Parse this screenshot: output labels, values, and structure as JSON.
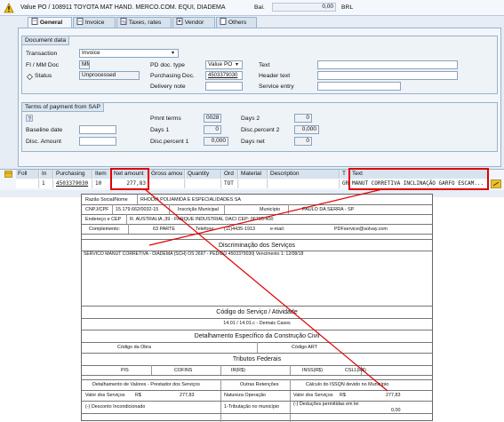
{
  "header": {
    "doc_title": "Value PO / 108911 TOYOTA MAT HAND. MERCO.COM. EQUI, DIADEMA",
    "bal_label": "Bal.",
    "bal_value": "0,00",
    "currency": "BRL"
  },
  "tabs": [
    {
      "label": "General",
      "active": true
    },
    {
      "label": "Invoice"
    },
    {
      "label": "Taxes, rates"
    },
    {
      "label": "Vendor"
    },
    {
      "label": "Others"
    }
  ],
  "document_data": {
    "title": "Document data",
    "transaction_label": "Transaction",
    "transaction_value": "Invoice",
    "fi_mm_label": "FI / MM Doc",
    "fi_mm_value": "MM",
    "status_label": "Status",
    "status_value": "Unprocessed",
    "pd_doc_type_label": "PD doc. type",
    "pd_doc_type_value": "Value PO",
    "purchasing_doc_label": "Purchasing Doc.",
    "purchasing_doc_value": "4503379030",
    "delivery_note_label": "Delivery note",
    "text_label": "Text",
    "header_text_label": "Header text",
    "service_entry_label": "Service entry"
  },
  "terms": {
    "title": "Terms of payment from SAP",
    "pmnt_terms_label": "Pmnt terms",
    "pmnt_terms_value": "0028",
    "days1_label": "Days 1",
    "days1_value": "0",
    "disc_pct1_label": "Disc.percent 1",
    "disc_pct1_value": "0,000",
    "days2_label": "Days 2",
    "days2_value": "0",
    "disc_pct2_label": "Disc.percent 2",
    "disc_pct2_value": "0,000",
    "days_net_label": "Days net",
    "days_net_value": "0",
    "baseline_date_label": "Baseline date",
    "disc_amount_label": "Disc. Amount"
  },
  "table": {
    "columns": [
      "Foll",
      "In",
      "Purchasing",
      "Item",
      "Net amount",
      "Gross amou",
      "Quantity",
      "Ord",
      "Material",
      "Description",
      "T",
      "Text"
    ],
    "row": {
      "in": "1",
      "purchasing": "4503379030",
      "item": "10",
      "net_amount": "277,83",
      "ord": "TOT",
      "t": "GR",
      "text": "MANUT CORRETIVA INCLINAÇÃO GARFO ESCAM..."
    }
  },
  "invoice_doc": {
    "razao_social_label": "Razão Social/Nome",
    "razao_social_value": "RHODIA POLIAMIDA E ESPECIALIDADES SA",
    "cnpj_label": "CNPJ/CPF",
    "cnpj_value": "15.179.662/0032-15",
    "inscricao_label": "Inscrição Municipal",
    "municipio_label": "Município",
    "municipio_value": "PAULO DA SERRA - SP",
    "endereco_label": "Endereço e CEP",
    "endereco_value": "R. AUSTRALIA ,39 - PARQUE INDUSTRIAL DACI CEP: 06785-400",
    "complemento_label": "Complemento:",
    "complemento_value": "63 PARTE",
    "telefone_label": "Telefone:",
    "telefone_value": "(11)4435-1913",
    "email_label": "e-mail:",
    "email_value": "PDFservice@solvay.com",
    "discriminacao_title": "Discriminação dos Serviços",
    "servico_text": "SERVICO MANUT CORRETIVA - DIADEMA (SCH) OS 2697 - PEDIDO 4503379030| Vencimento 1: 12/08/18",
    "codigo_servico_title": "Código do Serviço / Atividade",
    "codigo_servico_value": "14.01 / 14.01.c - Demais Casos",
    "construcao_title": "Detalhamento Específico da Construção Civil",
    "codigo_obra_label": "Código da Obra",
    "codigo_art_label": "Código ART",
    "tributos_title": "Tributos Federais",
    "pis_label": "PIS",
    "cofins_label": "COFINS",
    "ir_label": "IR(R$)",
    "inss_label": "INSS(R$)",
    "csll_label": "CSLL(R$)",
    "valores_title": "Detalhamento de Valores - Prestador dos Serviços",
    "outras_retencoes": "Outras Retenções",
    "calculo_issqn": "Cálculo do ISSQN devido no Município",
    "valor_servicos_label": "Valor dos Serviços",
    "rs": "R$",
    "valor_servicos_value": "277,83",
    "natureza_label": "Natureza Operação",
    "valor_servicos2_label": "Valor dos Serviços",
    "valor_servicos2_value": "277,83",
    "desconto_label": "(-) Desconto Incondicionado",
    "tributacao_value": "1-Tributação no município",
    "deducoes_label": "(-) Deduções permitidas em lei",
    "deducoes_value": "0,00"
  },
  "colors": {
    "annotation": "#e00000",
    "sap_bg": "#e6edf5"
  }
}
